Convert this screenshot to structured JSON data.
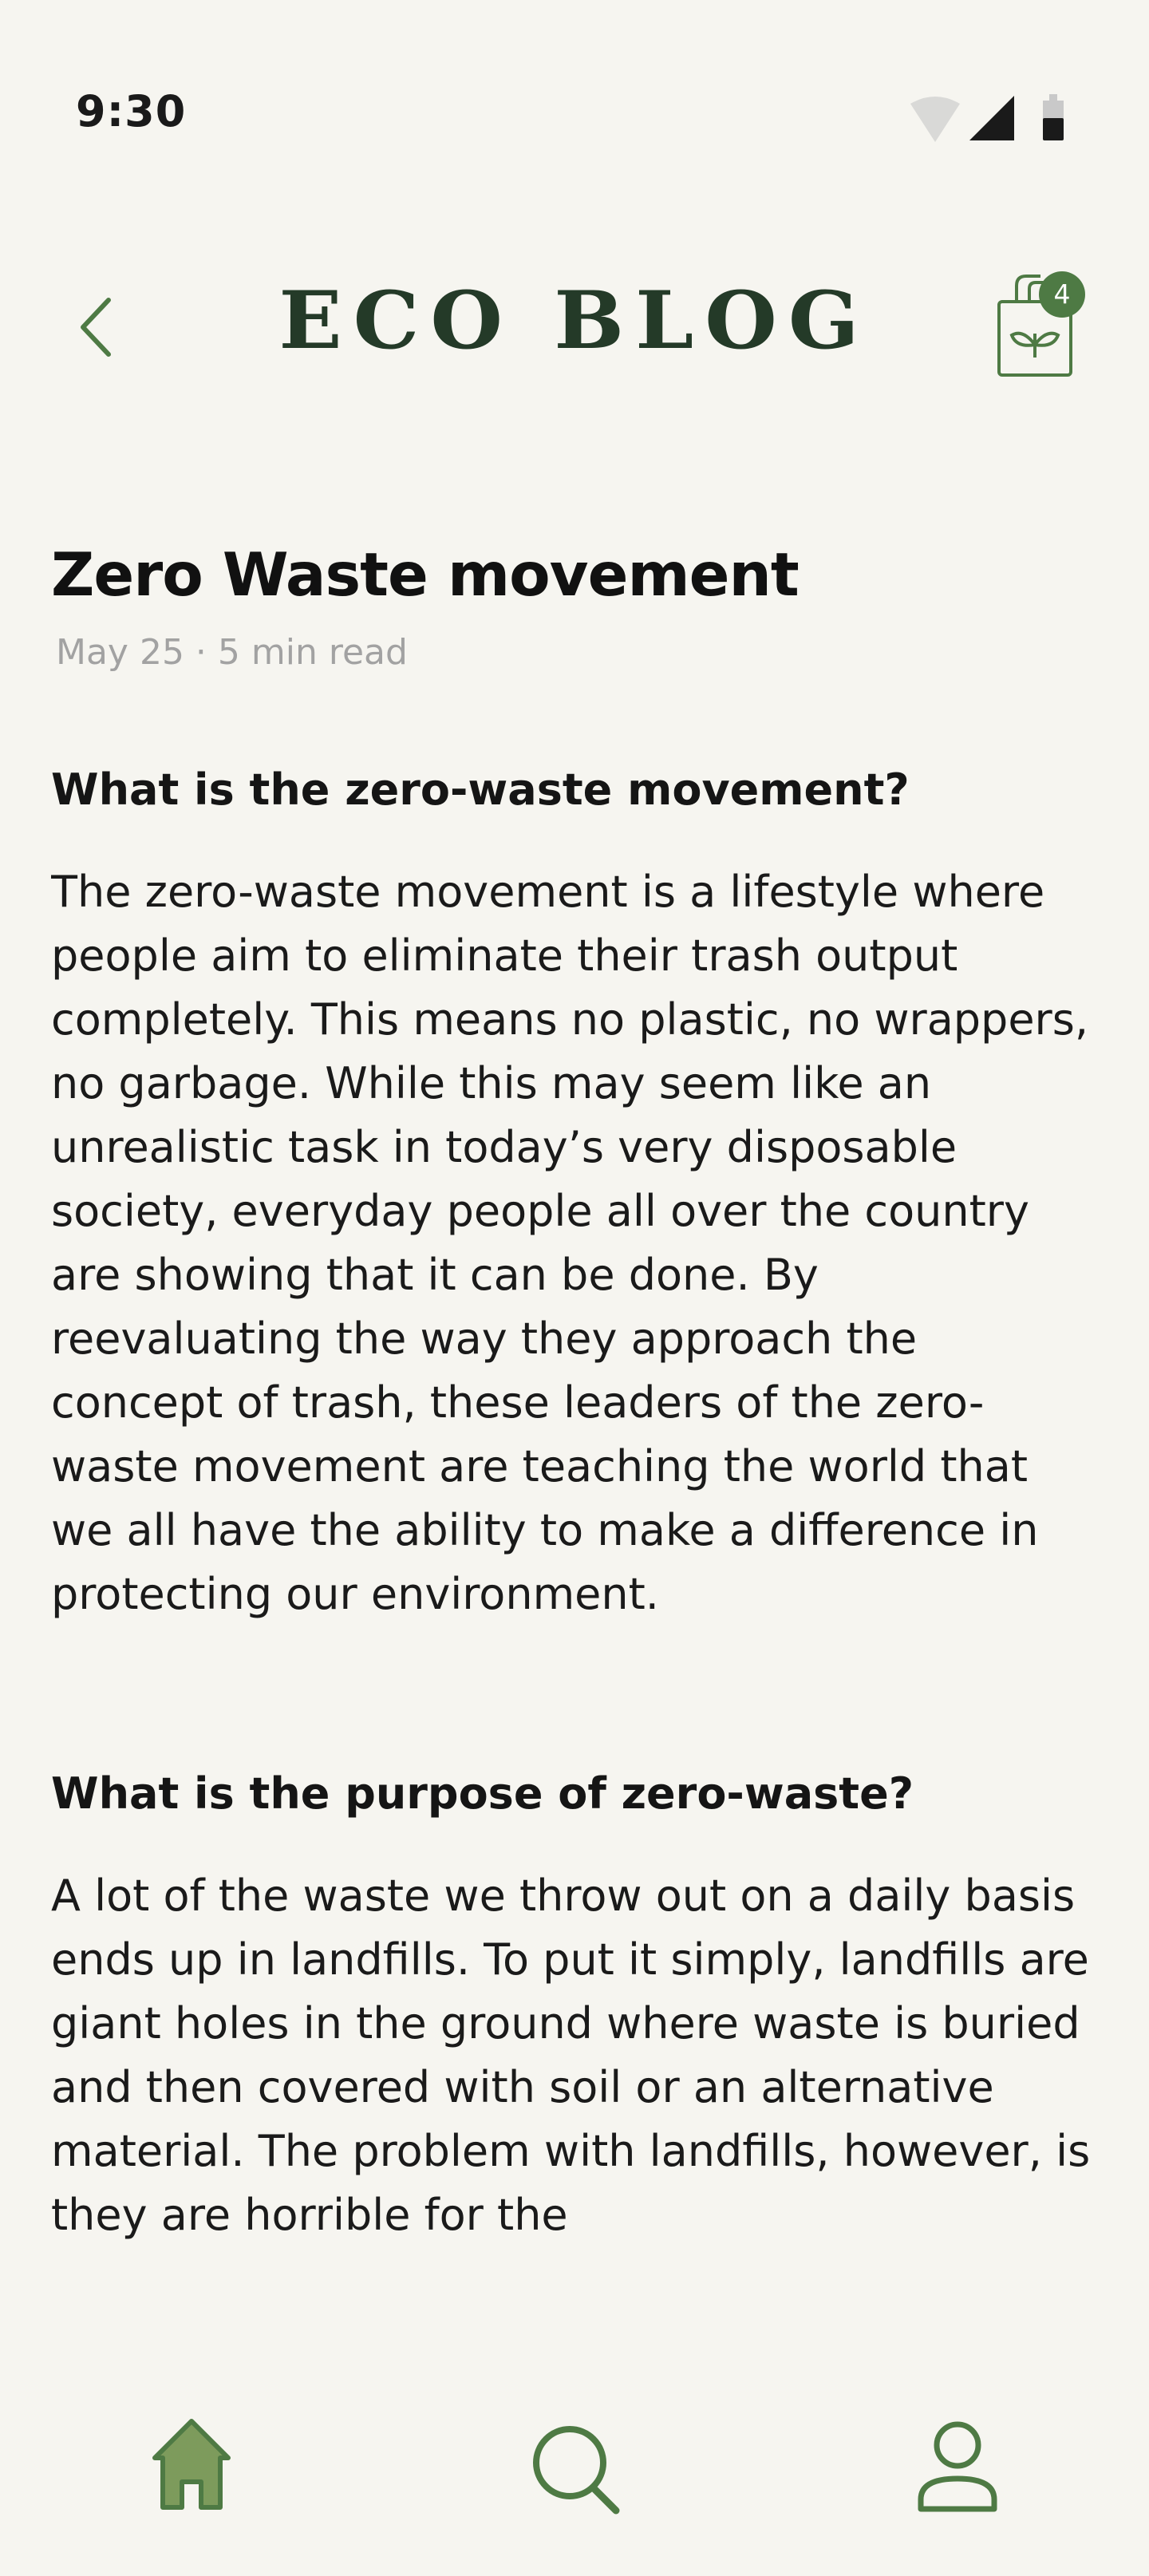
{
  "status_bar": {
    "time": "9:30",
    "icons": [
      "wifi-icon",
      "cellular-signal-icon",
      "battery-icon"
    ]
  },
  "header": {
    "brand_title": "ECO BLOG",
    "back_icon": "chevron-left-icon",
    "bag_icon": "eco-bag-icon",
    "bag_count": "4"
  },
  "article": {
    "title": "Zero Waste movement",
    "meta": "May 25 · 5 min read",
    "sections": [
      {
        "heading": "What is the zero-waste movement?",
        "body": "The zero-waste movement is a lifestyle where people aim to eliminate their trash output completely. This means no plastic, no wrappers, no garbage. While this may seem like an unrealistic task in today’s very disposable society, everyday people all over the country are showing that it can be done. By reevaluating the way they approach the concept of trash, these leaders of the zero-waste movement are teaching the world that we all have the ability to make a difference in protecting our environment."
      },
      {
        "heading": "What is the purpose of zero-waste?",
        "body": "A lot of the waste we throw out on a daily basis ends up in landfills. To put it simply, landfills are giant holes in the ground where waste is buried and then covered with soil or an alternative material. The problem with landfills, however, is they are horrible for the"
      }
    ]
  },
  "bottom_nav": {
    "items": [
      {
        "icon": "home-icon",
        "active": true
      },
      {
        "icon": "search-icon",
        "active": false
      },
      {
        "icon": "profile-icon",
        "active": false
      }
    ]
  },
  "colors": {
    "background": "#f6f5f0",
    "brand_dark": "#243a28",
    "accent_green": "#4e7a44",
    "home_fill": "#7d9b5c",
    "text": "#111111",
    "meta_text": "#a2a2a2"
  }
}
